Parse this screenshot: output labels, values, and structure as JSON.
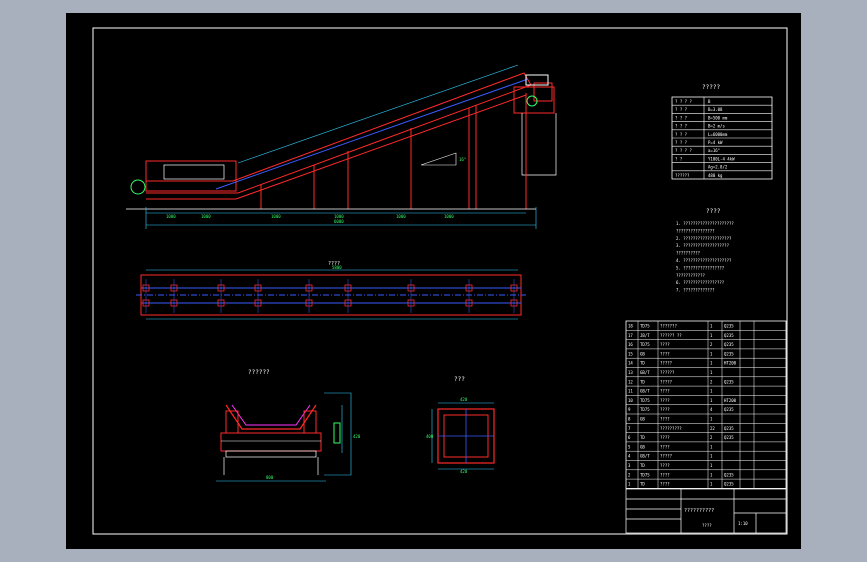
{
  "window": {
    "background": "#a8b0bd",
    "canvas": "#000000"
  },
  "colors": {
    "frame": "#ffffff",
    "struct": "#ff2a2a",
    "dim": "#33d0ff",
    "center": "#3a5cff",
    "text": "#ffffff",
    "green": "#33ff66",
    "magenta": "#ff33ff",
    "yellow": "#ffff33"
  },
  "views": {
    "plan_title": "????",
    "idler_title": "??????",
    "section_title": "???",
    "tech_params_title": "?????",
    "tech_req_title": "????",
    "drawing_title": "??????????",
    "company": "????",
    "scale_note": "1:10"
  },
  "tech_params": {
    "rows": [
      [
        "? ? ? ?",
        "B"
      ],
      [
        "? ? ?",
        "B=3.08"
      ],
      [
        "? ? ?",
        "B=500 mm"
      ],
      [
        "? ? ?",
        "B=2 m/s"
      ],
      [
        "? ? ?",
        "L=6000mm"
      ],
      [
        "? ? ?",
        "P=4 kW"
      ],
      [
        "? ? ? ?",
        "a=16°"
      ],
      [
        "? ?",
        "Y100L-4 4kW"
      ],
      [
        "",
        "Ag=2.8/2"
      ],
      [
        "??????",
        "480 kg"
      ]
    ]
  },
  "tech_req": {
    "lines": [
      "1. ?????????????????????",
      "  ????????????????",
      "2. ????????????????????",
      "3. ???????????????????",
      "  ??????????",
      "4. ????????????????????",
      "5. ?????????????????",
      "  ????????????",
      "6. ?????????????????",
      "7. ?????????????"
    ]
  },
  "bom": {
    "rows": [
      [
        "18",
        "TD75",
        "???????",
        "1",
        "Q235",
        "",
        ""
      ],
      [
        "17",
        "JB/T",
        "?????? ??",
        "1",
        "Q235",
        "",
        ""
      ],
      [
        "16",
        "TD75",
        "????",
        "2",
        "Q235",
        "",
        ""
      ],
      [
        "15",
        "GB",
        "????",
        "1",
        "Q235",
        "",
        ""
      ],
      [
        "14",
        "TD",
        "?????",
        "1",
        "HT200",
        "",
        ""
      ],
      [
        "13",
        "GB/T",
        "??????",
        "1",
        "",
        "",
        ""
      ],
      [
        "12",
        "TD",
        "?????",
        "2",
        "Q235",
        "",
        ""
      ],
      [
        "11",
        "GB/T",
        "????",
        "1",
        "",
        "",
        ""
      ],
      [
        "10",
        "TD75",
        "????",
        "1",
        "HT200",
        "",
        ""
      ],
      [
        "9",
        "TD75",
        "????",
        "4",
        "Q235",
        "",
        ""
      ],
      [
        "8",
        "GB",
        "????",
        "1",
        "",
        "",
        ""
      ],
      [
        "7",
        "",
        "?????????",
        "22",
        "Q235",
        "",
        ""
      ],
      [
        "6",
        "TD",
        "????",
        "2",
        "Q235",
        "",
        ""
      ],
      [
        "5",
        "GB",
        "????",
        "1",
        "",
        "",
        ""
      ],
      [
        "4",
        "GB/T",
        "?????",
        "1",
        "",
        "",
        ""
      ],
      [
        "3",
        "TD",
        "????",
        "1",
        "",
        "",
        ""
      ],
      [
        "2",
        "TD75",
        "????",
        "1",
        "Q235",
        "",
        ""
      ],
      [
        "1",
        "TD",
        "????",
        "1",
        "Q235",
        "",
        ""
      ]
    ]
  },
  "dims": {
    "overall_length": "6000",
    "plan_length": "5800",
    "belt_width": "500",
    "idler_width": "800",
    "idler_height": "420",
    "section_w": "420",
    "section_h": "400",
    "segments": [
      "1000",
      "1000",
      "1000",
      "1000",
      "1000",
      "1000"
    ],
    "incline": "16°"
  }
}
